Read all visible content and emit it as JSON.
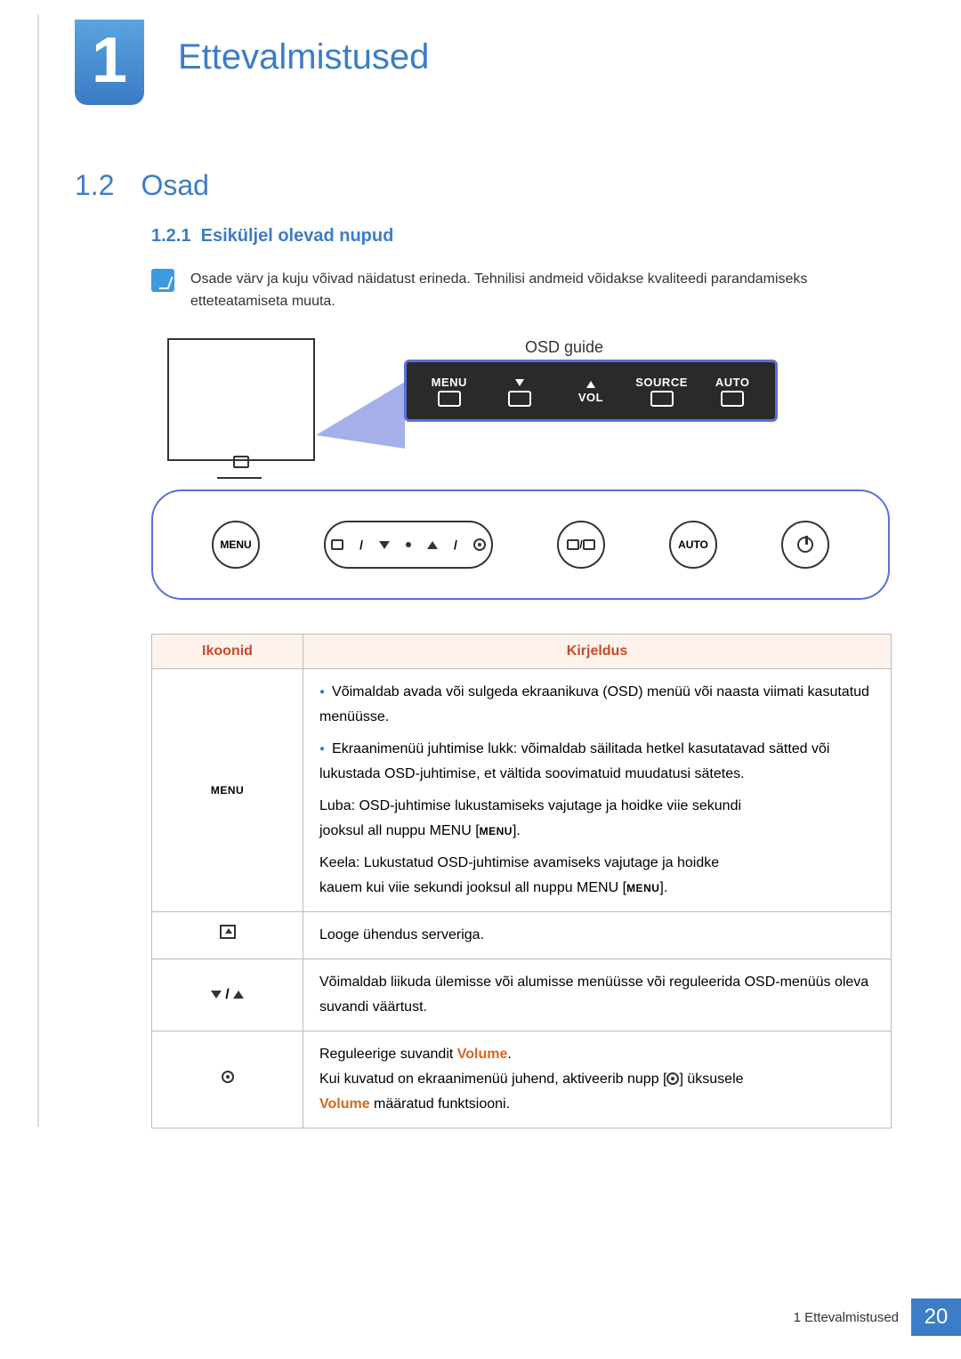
{
  "chapter": {
    "number": "1",
    "title": "Ettevalmistused"
  },
  "section": {
    "number": "1.2",
    "title": "Osad"
  },
  "subsection": {
    "number": "1.2.1",
    "title": "Esiküljel olevad nupud"
  },
  "note": "Osade värv ja kuju võivad näidatust erineda. Tehnilisi andmeid võidakse kvaliteedi parandamiseks etteteatamiseta muuta.",
  "diagram": {
    "osd_guide_label": "OSD guide",
    "callout": {
      "menu": "MENU",
      "vol": "VOL",
      "source": "SOURCE",
      "auto": "AUTO"
    },
    "panel": {
      "menu": "MENU",
      "auto": "AUTO"
    }
  },
  "table": {
    "headers": {
      "icons": "Ikoonid",
      "desc": "Kirjeldus"
    },
    "rows": [
      {
        "icon_label": "MENU",
        "desc": {
          "b1": "Võimaldab avada või sulgeda ekraanikuva (OSD) menüü või naasta viimati kasutatud menüüsse.",
          "b2": "Ekraanimenüü juhtimise lukk: võimaldab säilitada hetkel kasutatavad sätted või lukustada OSD-juhtimise, et vältida soovimatuid muudatusi sätetes.",
          "enable_pre": "Luba: OSD-juhtimise lukustamiseks vajutage ja hoidke viie sekundi",
          "enable_post": "jooksul all nuppu MENU [",
          "enable_end": "].",
          "disable_pre": "Keela: Lukustatud OSD-juhtimise avamiseks vajutage ja hoidke",
          "disable_post": "kauem kui viie sekundi jooksul all nuppu MENU [",
          "disable_end": "]."
        }
      },
      {
        "icon_label": "server-connect-icon",
        "desc": {
          "text": "Looge ühendus serveriga."
        }
      },
      {
        "icon_label": "up-down-icon",
        "desc": {
          "text": "Võimaldab liikuda ülemisse või alumisse menüüsse või reguleerida OSD-menüüs oleva suvandi väärtust."
        }
      },
      {
        "icon_label": "target-icon",
        "desc": {
          "line1_pre": "Reguleerige suvandit ",
          "line1_vol": "Volume",
          "line1_post": ".",
          "line2_pre": "Kui kuvatud on ekraanimenüü juhend, aktiveerib nupp [",
          "line2_post": "] üksusele",
          "line3_vol": "Volume",
          "line3_post": " määratud funktsiooni."
        }
      }
    ]
  },
  "footer": {
    "chapter_ref": "1 Ettevalmistused",
    "page": "20"
  }
}
